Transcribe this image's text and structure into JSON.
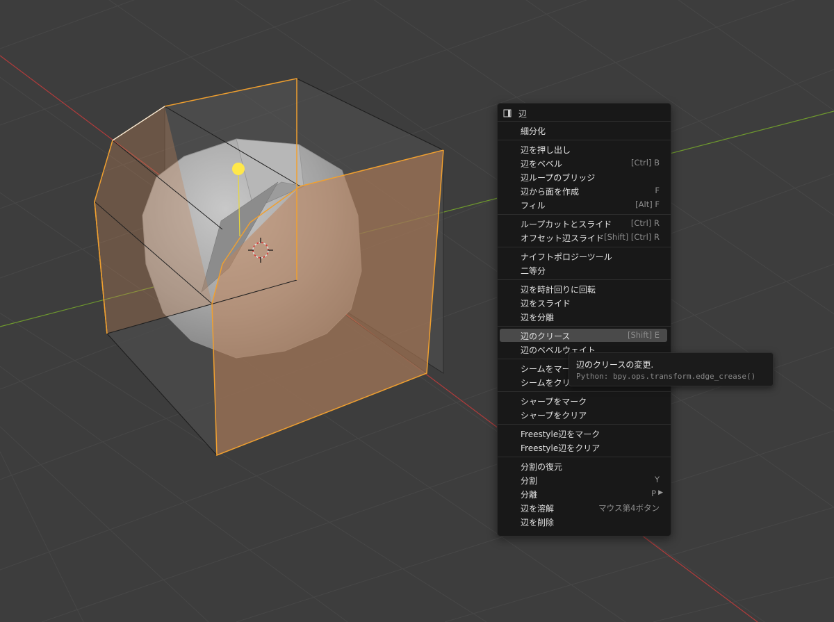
{
  "context_menu": {
    "title": "辺",
    "title_icon": "edge-select-mode-icon",
    "groups": [
      {
        "items": [
          {
            "label": "細分化",
            "shortcut": ""
          }
        ]
      },
      {
        "items": [
          {
            "label": "辺を押し出し",
            "shortcut": ""
          },
          {
            "label": "辺をベベル",
            "shortcut": "[Ctrl] B"
          },
          {
            "label": "辺ループのブリッジ",
            "shortcut": ""
          },
          {
            "label": "辺から面を作成",
            "shortcut": "F"
          },
          {
            "label": "フィル",
            "shortcut": "[Alt] F"
          }
        ]
      },
      {
        "items": [
          {
            "label": "ループカットとスライド",
            "shortcut": "[Ctrl] R"
          },
          {
            "label": "オフセット辺スライド",
            "shortcut": "[Shift] [Ctrl] R"
          }
        ]
      },
      {
        "items": [
          {
            "label": "ナイフトポロジーツール",
            "shortcut": ""
          },
          {
            "label": "二等分",
            "shortcut": ""
          }
        ]
      },
      {
        "items": [
          {
            "label": "辺を時計回りに回転",
            "shortcut": ""
          },
          {
            "label": "辺をスライド",
            "shortcut": ""
          },
          {
            "label": "辺を分離",
            "shortcut": ""
          }
        ]
      },
      {
        "items": [
          {
            "label": "辺のクリース",
            "shortcut": "[Shift] E",
            "highlighted": true
          },
          {
            "label": "辺のベベルウェイト",
            "shortcut": ""
          }
        ]
      },
      {
        "items": [
          {
            "label": "シームをマーク",
            "shortcut": ""
          },
          {
            "label": "シームをクリア",
            "shortcut": ""
          }
        ]
      },
      {
        "items": [
          {
            "label": "シャープをマーク",
            "shortcut": ""
          },
          {
            "label": "シャープをクリア",
            "shortcut": ""
          }
        ]
      },
      {
        "items": [
          {
            "label": "Freestyle辺をマーク",
            "shortcut": ""
          },
          {
            "label": "Freestyle辺をクリア",
            "shortcut": ""
          }
        ]
      },
      {
        "items": [
          {
            "label": "分割の復元",
            "shortcut": ""
          },
          {
            "label": "分割",
            "shortcut": "Y"
          },
          {
            "label": "分離",
            "shortcut": "P",
            "submenu": true
          },
          {
            "label": "辺を溶解",
            "shortcut": "マウス第4ボタン"
          },
          {
            "label": "辺を削除",
            "shortcut": ""
          }
        ]
      }
    ]
  },
  "tooltip": {
    "title": "辺のクリースの変更.",
    "python": "Python: bpy.ops.transform.edge_crease()"
  },
  "colors": {
    "background": "#3d3d3d",
    "grid": "#474747",
    "x_axis": "#b23b3b",
    "y_axis": "#6f9a2e",
    "selection_edge": "#f0a030",
    "selection_face": "#c0845a",
    "mesh": "#a8a8a8",
    "light": "#ffe84a",
    "menu_bg": "#181818",
    "menu_highlight": "#4a4a4a"
  }
}
